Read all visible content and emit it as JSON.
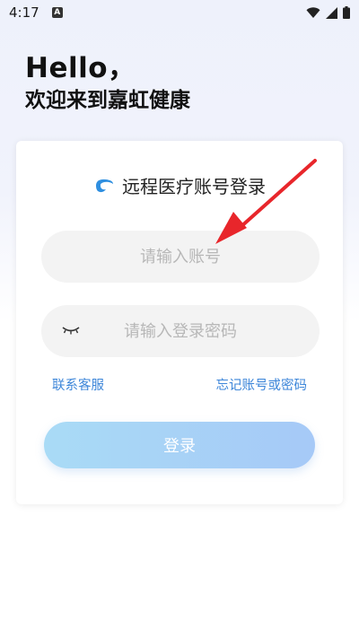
{
  "status_bar": {
    "time": "4:17",
    "notification_letter": "A"
  },
  "greeting": {
    "title": "Hello，",
    "subtitle": "欢迎来到嘉虹健康"
  },
  "login_card": {
    "title": "远程医疗账号登录",
    "logo_icon": "swirl-logo-icon",
    "account_input": {
      "placeholder": "请输入账号",
      "value": ""
    },
    "password_input": {
      "placeholder": "请输入登录密码",
      "value": ""
    },
    "contact_link": "联系客服",
    "forgot_link": "忘记账号或密码",
    "login_button": "登录"
  },
  "colors": {
    "accent_blue": "#3d86d9",
    "button_gradient_start": "#a9dbf6",
    "button_gradient_end": "#a6c9f7",
    "annotation_arrow": "#e8262b"
  }
}
